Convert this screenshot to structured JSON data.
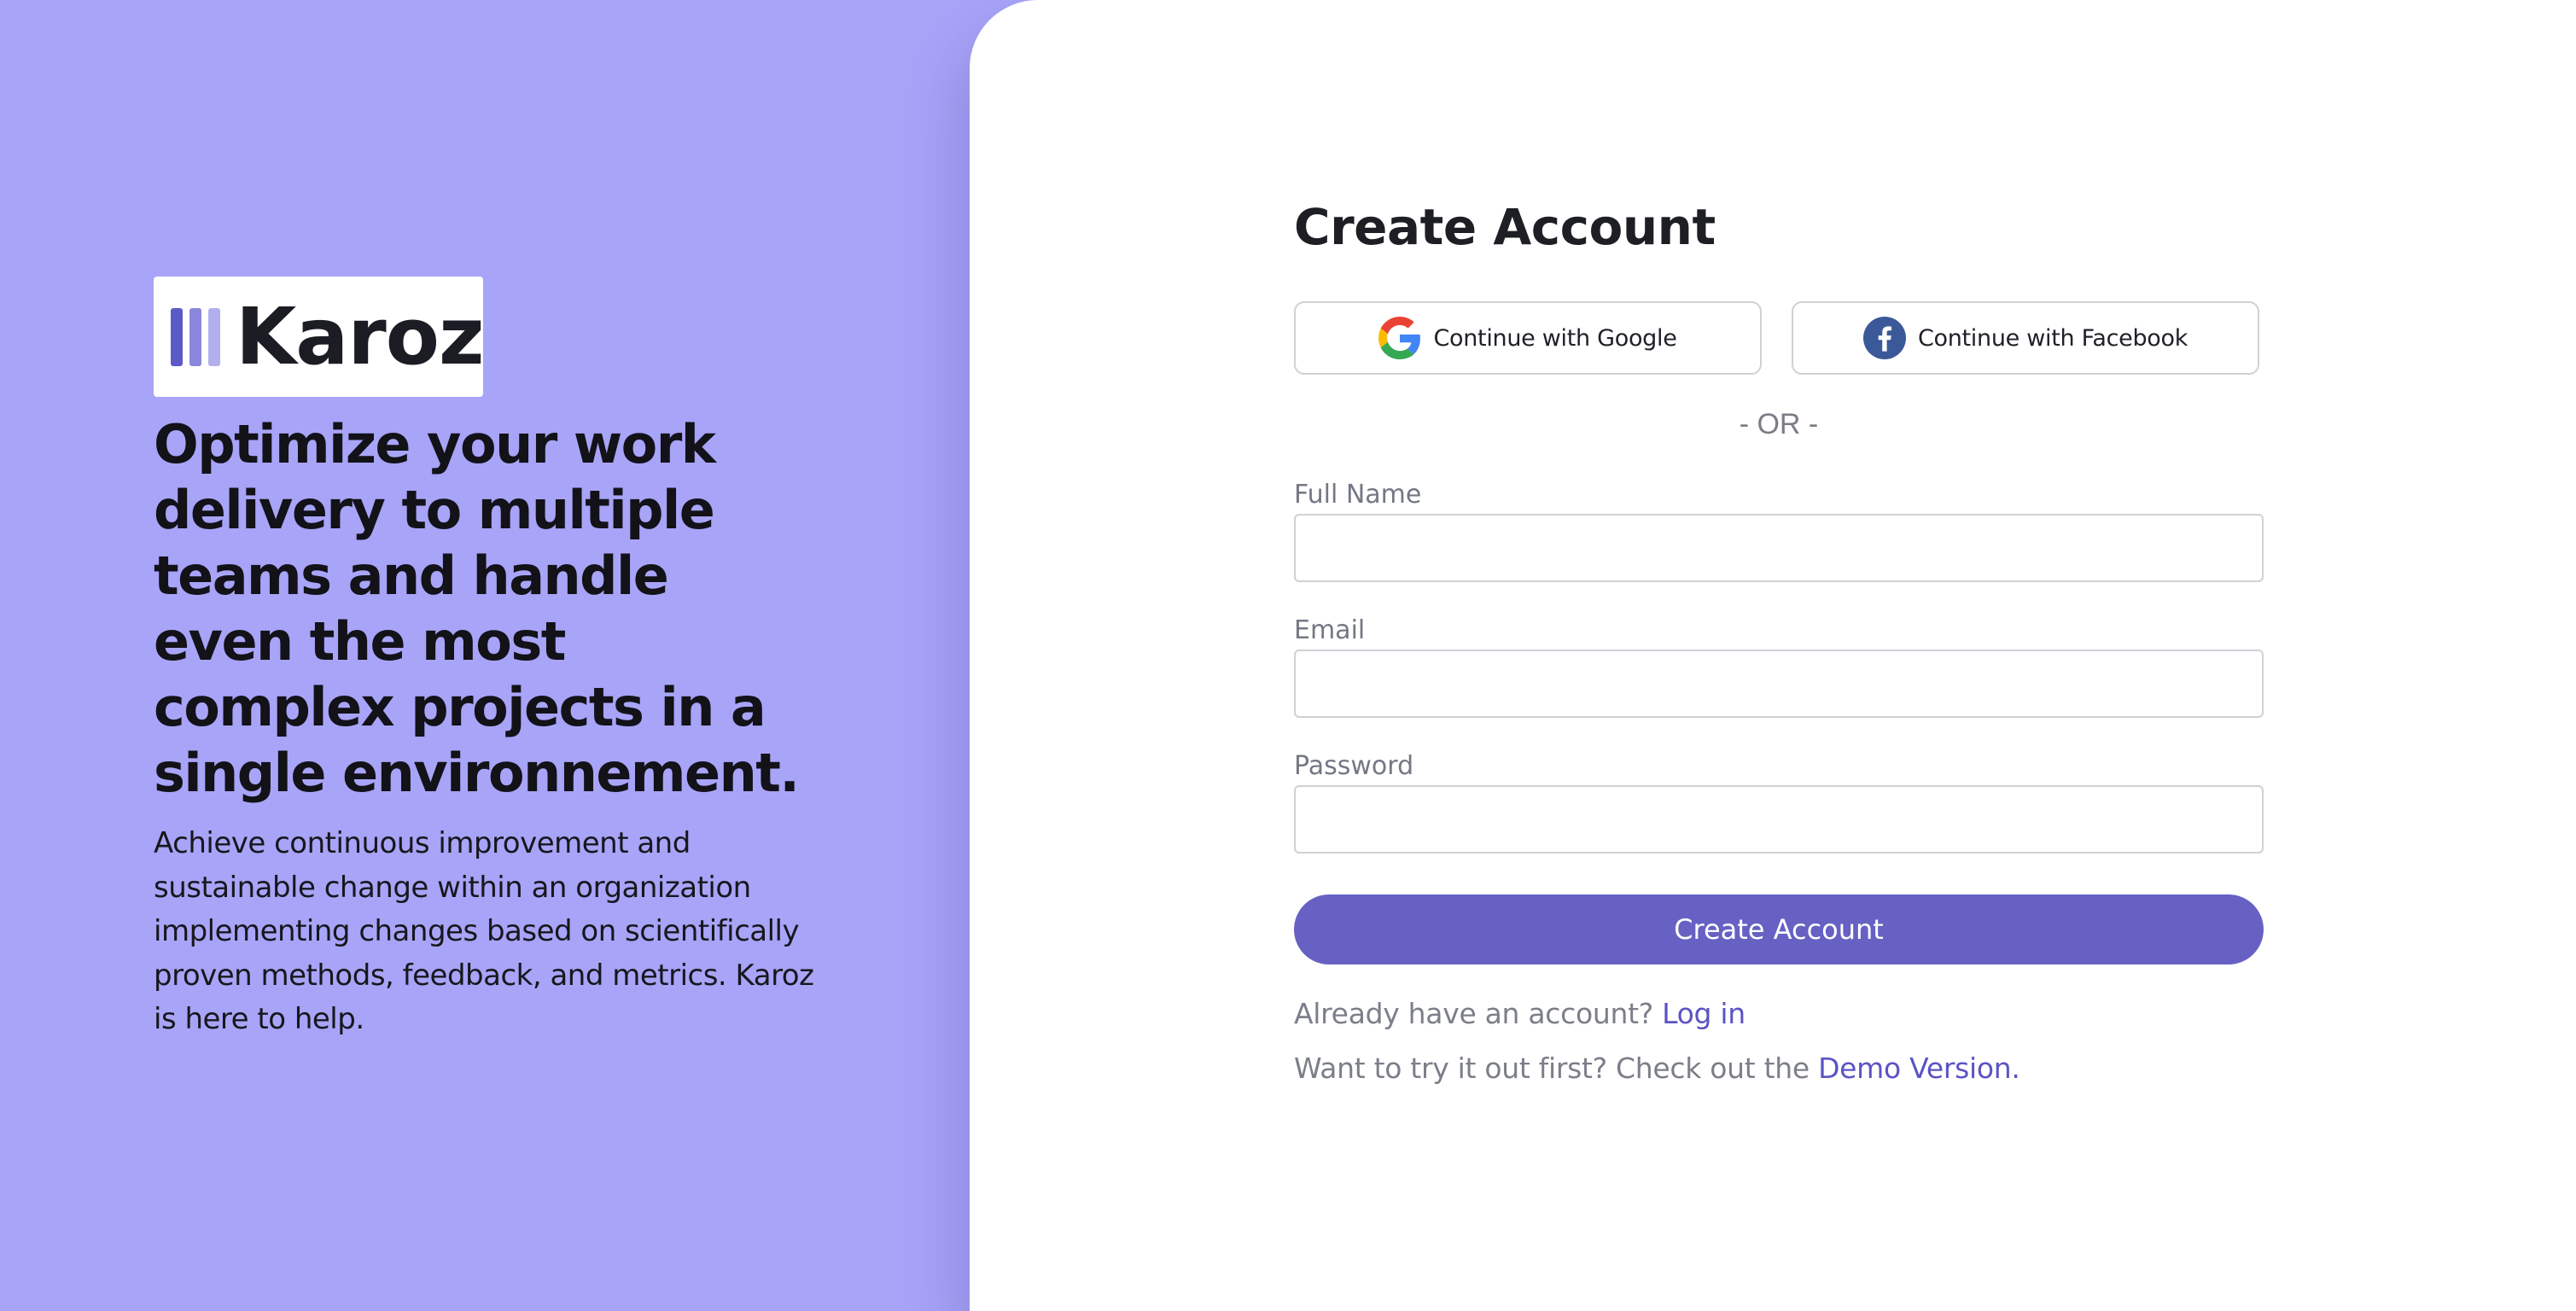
{
  "brand": {
    "name": "Karoz",
    "logo_icon": "three-bars-logo",
    "colors": {
      "bar1": "#5c5ac6",
      "bar2": "#8a87dc",
      "bar3": "#b2b0ec"
    }
  },
  "hero": {
    "headline": "Optimize your work delivery to multiple teams and handle even the most complex projects in a single environnement.",
    "description": "Achieve continuous improvement and sustainable change within an organization implementing changes based on scientifically proven methods, feedback, and metrics. Karoz is here to help."
  },
  "form": {
    "title": "Create Account",
    "google_label": "Continue with Google",
    "facebook_label": "Continue with Facebook",
    "google_icon": "google-icon",
    "facebook_icon": "facebook-icon",
    "separator": "- OR -",
    "fields": {
      "full_name": {
        "label": "Full Name",
        "value": "",
        "placeholder": ""
      },
      "email": {
        "label": "Email",
        "value": "",
        "placeholder": ""
      },
      "password": {
        "label": "Password",
        "value": "",
        "placeholder": ""
      }
    },
    "submit_label": "Create Account",
    "login_prompt": "Already have an account?",
    "login_link": "Log in",
    "demo_prompt": "Want to try it out first? Check out the",
    "demo_link": "Demo Version."
  },
  "colors": {
    "left_background": "#a8a4f8",
    "accent": "#6661c3",
    "link": "#5a54c4"
  }
}
